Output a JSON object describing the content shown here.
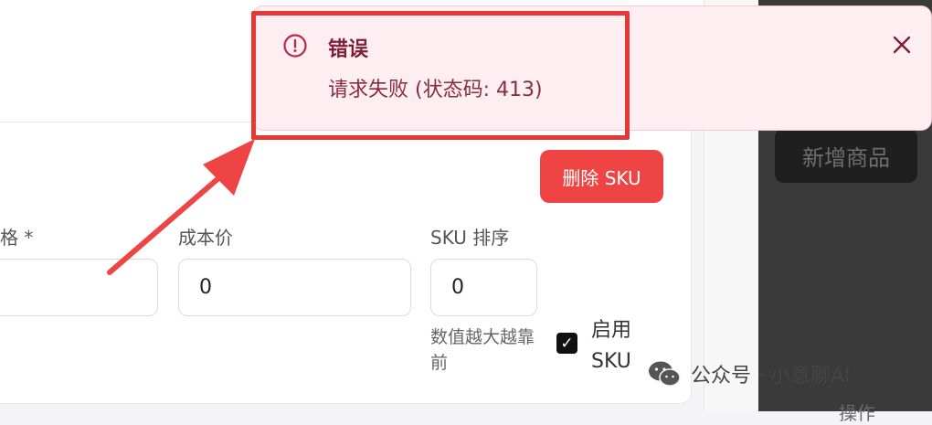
{
  "toolbar": {
    "add_product_label": "新增商品"
  },
  "footer": {
    "column_label": "操作"
  },
  "sku_form": {
    "delete_sku_label": "删除 SKU",
    "name_label_fragment": "格 *",
    "cost_price_label": "成本价",
    "cost_price_value": "0",
    "sku_order_label": "SKU 排序",
    "sku_order_value": "0",
    "sku_order_hint": "数值越大越靠前",
    "enable_sku_label": "启用 SKU",
    "enable_sku_checked": true
  },
  "toast": {
    "type": "error",
    "title": "错误",
    "message": "请求失败 (状态码: 413)",
    "icon": "alert-circle-icon",
    "close_icon": "close-icon"
  },
  "watermark": {
    "text": "公众号 · 小意聊AI",
    "icon": "wechat-icon"
  },
  "colors": {
    "danger": "#ef4444",
    "toast_bg": "#fdeff1",
    "toast_text": "#7f1d3a",
    "highlight": "#e53935",
    "dark_panel": "#3a3a3a"
  }
}
